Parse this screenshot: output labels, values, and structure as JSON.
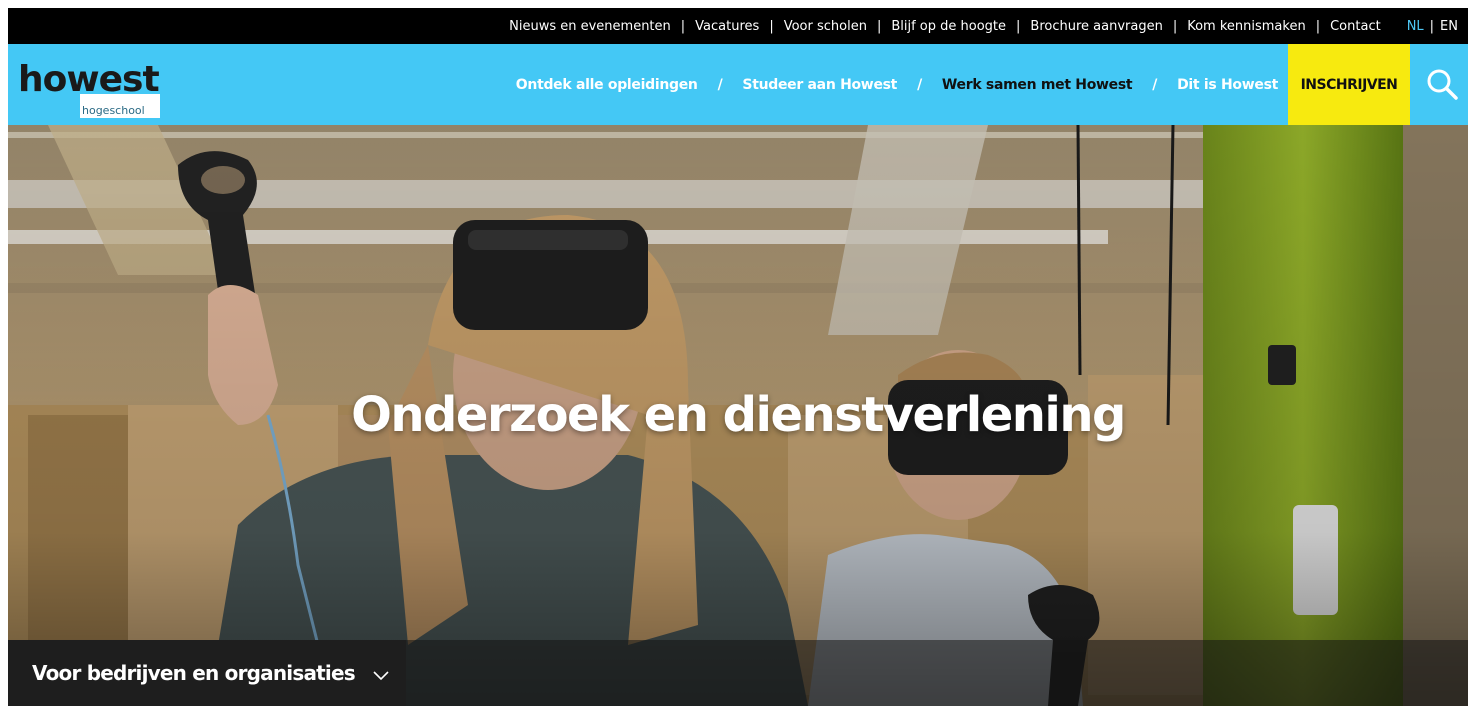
{
  "topbar": {
    "links": [
      "Nieuws en evenementen",
      "Vacatures",
      "Voor scholen",
      "Blijf op de hoogte",
      "Brochure aanvragen",
      "Kom kennismaken",
      "Contact"
    ],
    "separator": "|",
    "lang_active": "NL",
    "lang_sep": "|",
    "lang_other": "EN"
  },
  "logo": {
    "word": "howest",
    "sub": "hogeschool"
  },
  "mainnav": {
    "items": [
      "Ontdek alle opleidingen",
      "Studeer aan Howest",
      "Werk samen met Howest",
      "Dit is Howest"
    ],
    "separator": "/",
    "cta": "INSCHRIJVEN"
  },
  "hero": {
    "title": "Onderzoek en dienstverlening"
  },
  "dropdown": {
    "label": "Voor bedrijven en organisaties"
  },
  "colors": {
    "brand_blue": "#44c8f5",
    "cta_yellow": "#f7ea0f",
    "topbar": "#000000"
  },
  "icons": {
    "search": "search-icon",
    "chevron": "chevron-down-icon"
  }
}
